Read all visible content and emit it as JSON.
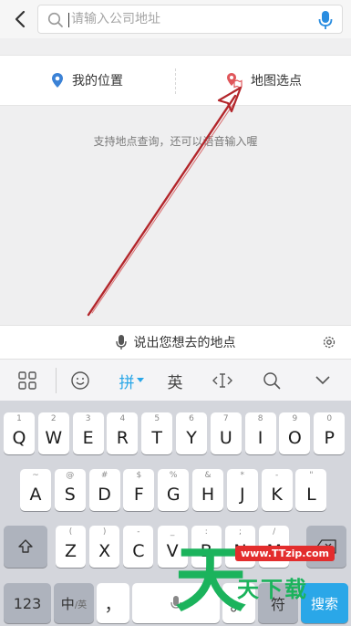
{
  "search": {
    "placeholder": "请输入公司地址",
    "value": ""
  },
  "location": {
    "my_location": "我的位置",
    "map_pick": "地图选点"
  },
  "hint": "支持地点查询，还可以语音输入喔",
  "voice_bar": {
    "label": "说出您想去的地点"
  },
  "toolbar": {
    "pinyin": "拼",
    "english": "英"
  },
  "keyboard": {
    "row1": [
      {
        "sup": "1",
        "key": "Q"
      },
      {
        "sup": "2",
        "key": "W"
      },
      {
        "sup": "3",
        "key": "E"
      },
      {
        "sup": "4",
        "key": "R"
      },
      {
        "sup": "5",
        "key": "T"
      },
      {
        "sup": "6",
        "key": "Y"
      },
      {
        "sup": "7",
        "key": "U"
      },
      {
        "sup": "8",
        "key": "I"
      },
      {
        "sup": "9",
        "key": "O"
      },
      {
        "sup": "0",
        "key": "P"
      }
    ],
    "row2": [
      {
        "sup": "~",
        "key": "A"
      },
      {
        "sup": "@",
        "key": "S"
      },
      {
        "sup": "#",
        "key": "D"
      },
      {
        "sup": "$",
        "key": "F"
      },
      {
        "sup": "%",
        "key": "G"
      },
      {
        "sup": "&",
        "key": "H"
      },
      {
        "sup": "*",
        "key": "J"
      },
      {
        "sup": "-",
        "key": "K"
      },
      {
        "sup": "\"",
        "key": "L"
      }
    ],
    "row3": [
      {
        "sup": "(",
        "key": "Z"
      },
      {
        "sup": ")",
        "key": "X"
      },
      {
        "sup": "-",
        "key": "C"
      },
      {
        "sup": "_",
        "key": "V"
      },
      {
        "sup": ":",
        "key": "B"
      },
      {
        "sup": ";",
        "key": "N"
      },
      {
        "sup": "/",
        "key": "M"
      }
    ],
    "num_key": "123",
    "lang_key_main": "中",
    "lang_key_sub": "/英",
    "comma_key": "，",
    "period_key": "。",
    "symbol_key": "符",
    "search_key": "搜索"
  },
  "watermark": {
    "url": "www.TTzip.com",
    "big": "天",
    "small": "天下载"
  },
  "colors": {
    "accent": "#2aa7e8",
    "pin_blue": "#3b82d6",
    "pin_red": "#e0575b",
    "arrow": "#b3262b"
  }
}
